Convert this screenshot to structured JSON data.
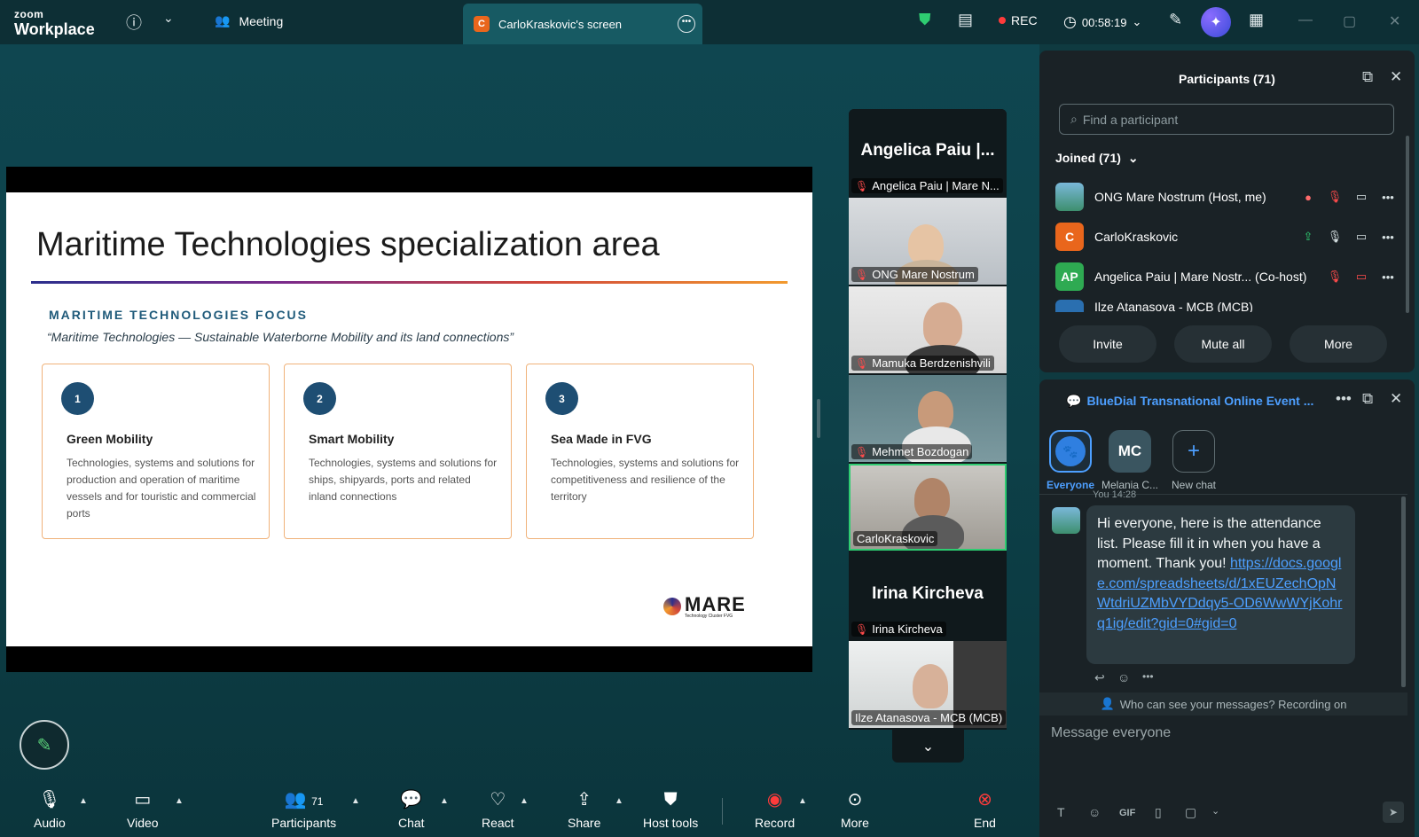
{
  "app": {
    "logo_top": "zoom",
    "logo_bottom": "Workplace"
  },
  "topbar": {
    "meeting_label": "Meeting",
    "screen_tab_initial": "C",
    "screen_tab_label": "CarloKraskovic's screen",
    "rec_label": "REC",
    "timer": "00:58:19"
  },
  "slide": {
    "title": "Maritime Technologies specialization area",
    "focus_heading": "MARITIME TECHNOLOGIES FOCUS",
    "quote": "“Maritime Technologies — Sustainable Waterborne Mobility and its land connections”",
    "cards": [
      {
        "num": "1",
        "title": "Green Mobility",
        "desc": "Technologies, systems and solutions for production and operation of maritime vessels and for touristic and commercial ports"
      },
      {
        "num": "2",
        "title": "Smart Mobility",
        "desc": "Technologies, systems and solutions for ships, shipyards, ports and related inland connections"
      },
      {
        "num": "3",
        "title": "Sea Made in FVG",
        "desc": "Technologies, systems and solutions for competitiveness and resilience of the territory"
      }
    ],
    "logo_text": "MARE",
    "logo_sub": "Technology Cluster FVG"
  },
  "gallery": {
    "tiles": [
      {
        "big": "Angelica Paiu |...",
        "name": "Angelica Paiu | Mare N..."
      },
      {
        "name": "ONG Mare Nostrum"
      },
      {
        "name": "Mamuka Berdzenishvili"
      },
      {
        "name": "Mehmet Bozdogan"
      },
      {
        "name": "CarloKraskovic"
      },
      {
        "big": "Irina Kircheva",
        "name": "Irina Kircheva"
      },
      {
        "name": "Ilze Atanasova - MCB (MCB)"
      }
    ]
  },
  "participants": {
    "title": "Participants (71)",
    "search_placeholder": "Find a participant",
    "joined": "Joined (71)",
    "rows": [
      {
        "initials": "",
        "name": "ONG Mare Nostrum (Host, me)"
      },
      {
        "initials": "C",
        "name": "CarloKraskovic"
      },
      {
        "initials": "AP",
        "name": "Angelica Paiu | Mare Nostr... (Co-host)"
      },
      {
        "initials": "",
        "name": "Ilze Atanasova - MCB (MCB)"
      }
    ],
    "buttons": {
      "invite": "Invite",
      "mute_all": "Mute all",
      "more": "More"
    }
  },
  "chat": {
    "title": "BlueDial Transnational Online Event ...",
    "tabs": [
      {
        "label": "Everyone"
      },
      {
        "initials": "MC",
        "label": "Melania C..."
      },
      {
        "label": "New chat"
      }
    ],
    "sender_time": "You 14:28",
    "message": "Hi everyone, here is the attendance list. Please fill it in when you have a moment. Thank you!",
    "link": "https://docs.google.com/spreadsheets/d/1xEUZechOpNWtdriUZMbVYDdqy5-OD6WwWYjKohrq1ig/edit?gid=0#gid=0",
    "notice": "Who can see your messages? Recording on",
    "compose_placeholder": "Message everyone",
    "gif_label": "GIF"
  },
  "toolbar": {
    "audio": "Audio",
    "video": "Video",
    "participants": "Participants",
    "participants_count": "71",
    "chat": "Chat",
    "react": "React",
    "share": "Share",
    "host_tools": "Host tools",
    "record": "Record",
    "more": "More",
    "end": "End"
  }
}
